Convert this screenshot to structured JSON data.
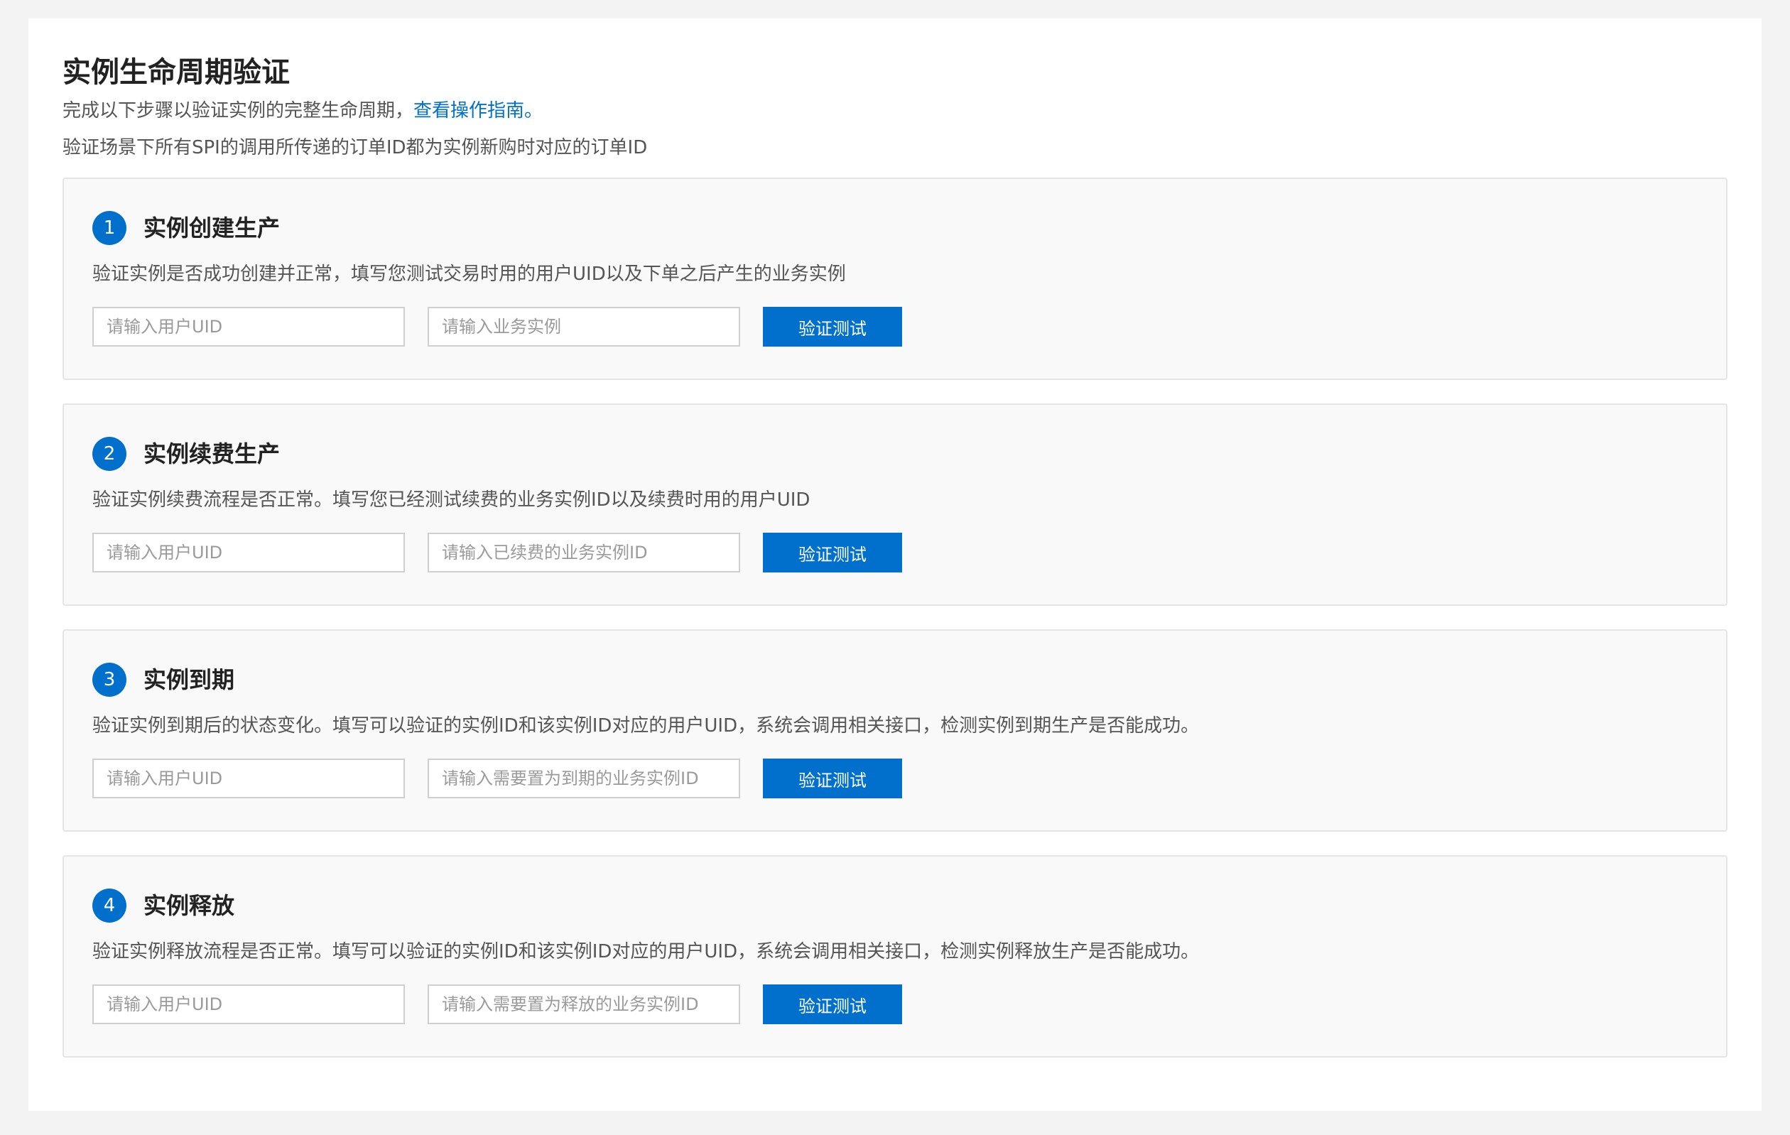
{
  "page": {
    "title": "实例生命周期验证",
    "intro_text": "完成以下步骤以验证实例的完整生命周期，",
    "intro_link": "查看操作指南。",
    "note": "验证场景下所有SPI的调用所传递的订单ID都为实例新购时对应的订单ID"
  },
  "steps": [
    {
      "number": "1",
      "title": "实例创建生产",
      "description": "验证实例是否成功创建并正常，填写您测试交易时用的用户UID以及下单之后产生的业务实例",
      "uid_value": "",
      "uid_placeholder": "请输入用户UID",
      "instance_value": "",
      "instance_placeholder": "请输入业务实例",
      "button_label": "验证测试"
    },
    {
      "number": "2",
      "title": "实例续费生产",
      "description": "验证实例续费流程是否正常。填写您已经测试续费的业务实例ID以及续费时用的用户UID",
      "uid_value": "",
      "uid_placeholder": "请输入用户UID",
      "instance_value": "",
      "instance_placeholder": "请输入已续费的业务实例ID",
      "button_label": "验证测试"
    },
    {
      "number": "3",
      "title": "实例到期",
      "description": "验证实例到期后的状态变化。填写可以验证的实例ID和该实例ID对应的用户UID，系统会调用相关接口，检测实例到期生产是否能成功。",
      "uid_value": "",
      "uid_placeholder": "请输入用户UID",
      "instance_value": "",
      "instance_placeholder": "请输入需要置为到期的业务实例ID",
      "button_label": "验证测试"
    },
    {
      "number": "4",
      "title": "实例释放",
      "description": "验证实例释放流程是否正常。填写可以验证的实例ID和该实例ID对应的用户UID，系统会调用相关接口，检测实例释放生产是否能成功。",
      "uid_value": "",
      "uid_placeholder": "请输入用户UID",
      "instance_value": "",
      "instance_placeholder": "请输入需要置为释放的业务实例ID",
      "button_label": "验证测试"
    }
  ],
  "colors": {
    "accent": "#0070cc",
    "page_background": "#f3f3f3",
    "card_background": "#ffffff",
    "step_background": "#f9f9f9",
    "step_border": "#e5e5e5",
    "text_primary": "#222222",
    "text_secondary": "#555555",
    "placeholder": "#9a9a9a"
  }
}
